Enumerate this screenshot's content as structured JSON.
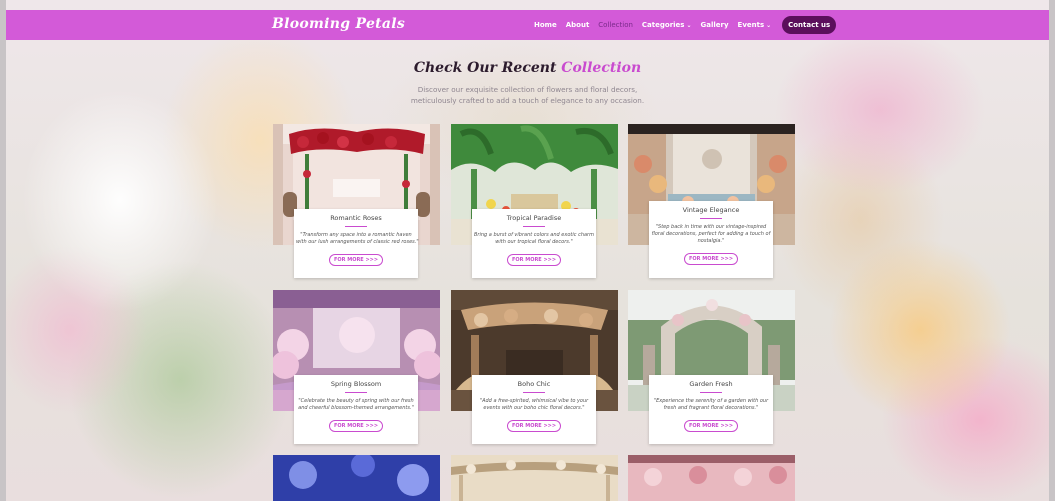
{
  "site": {
    "logo": "Blooming Petals"
  },
  "nav": {
    "items": [
      {
        "label": "Home",
        "active": false,
        "dropdown": false
      },
      {
        "label": "About",
        "active": false,
        "dropdown": false
      },
      {
        "label": "Collection",
        "active": true,
        "dropdown": false
      },
      {
        "label": "Categories",
        "active": false,
        "dropdown": true
      },
      {
        "label": "Gallery",
        "active": false,
        "dropdown": false
      },
      {
        "label": "Events",
        "active": false,
        "dropdown": true
      }
    ],
    "contact_label": "Contact us"
  },
  "section": {
    "heading_main": "Check Our Recent",
    "heading_accent": "Collection",
    "subtitle_line1": "Discover our exquisite collection of flowers and floral decors,",
    "subtitle_line2": "meticulously crafted to add a touch of elegance to any occasion."
  },
  "cards": [
    {
      "title": "Romantic Roses",
      "desc1": "\"Transform any space into a romantic haven",
      "desc2": "with our lush arrangements of classic red roses.\"",
      "desc3": "",
      "more": "FOR MORE >>>"
    },
    {
      "title": "Tropical Paradise",
      "desc1": "Bring a burst of vibrant colors and exotic charm",
      "desc2": "with our tropical floral decors.\"",
      "desc3": "",
      "more": "FOR MORE >>>"
    },
    {
      "title": "Vintage Elegance",
      "desc1": "\"Step back in time with our vintage-inspired",
      "desc2": "floral decorations, perfect for adding a touch of",
      "desc3": "nostalgia.\"",
      "more": "FOR MORE >>>"
    },
    {
      "title": "Spring Blossom",
      "desc1": "\"Celebrate the beauty of spring with our fresh",
      "desc2": "and cheerful blossom-themed arrangements.\"",
      "desc3": "",
      "more": "FOR MORE >>>"
    },
    {
      "title": "Boho Chic",
      "desc1": "\"Add a free-spirited, whimsical vibe to your",
      "desc2": "events with our boho chic floral decors.\"",
      "desc3": "",
      "more": "FOR MORE >>>"
    },
    {
      "title": "Garden Fresh",
      "desc1": "\"Experience the serenity of a garden with our",
      "desc2": "fresh and fragrant floral decorations.\"",
      "desc3": "",
      "more": "FOR MORE >>>"
    }
  ],
  "colors": {
    "navbar": "#d35ad8",
    "accent": "#c94bcf",
    "contact_bg": "#5b0f5c"
  }
}
